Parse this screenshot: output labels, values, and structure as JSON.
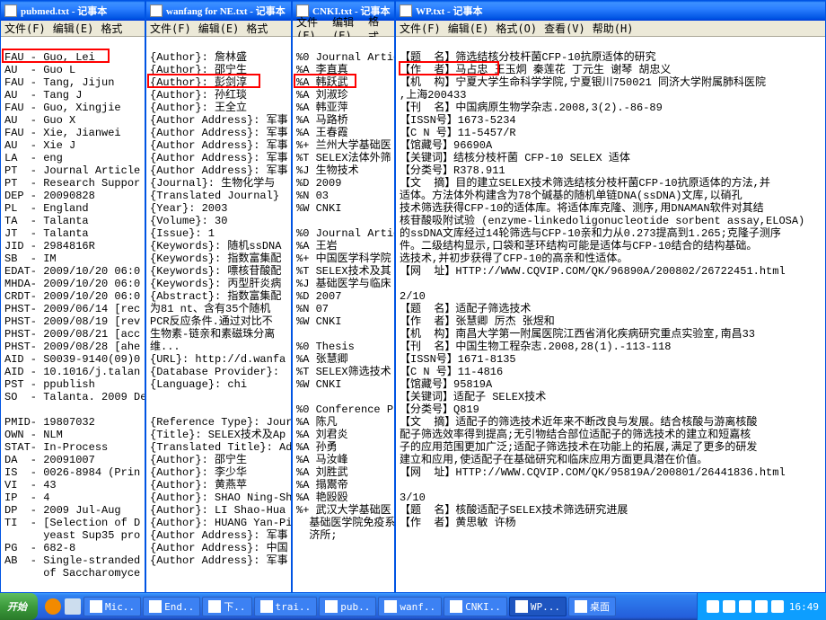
{
  "windows": {
    "pubmed": {
      "title": "pubmed.txt - 记事本",
      "menu": [
        "文件(F)",
        "编辑(E)",
        "格式"
      ],
      "lines": [
        "",
        "FAU - Guo, Lei",
        "AU  - Guo L",
        "FAU - Tang, Jijun",
        "AU  - Tang J",
        "FAU - Guo, Xingjie",
        "AU  - Guo X",
        "FAU - Xie, Jianwei",
        "AU  - Xie J",
        "LA  - eng",
        "PT  - Journal Article",
        "PT  - Research Suppor",
        "DEP - 20090828",
        "PL  - England",
        "TA  - Talanta",
        "JT  - Talanta",
        "JID - 2984816R",
        "SB  - IM",
        "EDAT- 2009/10/20 06:0",
        "MHDA- 2009/10/20 06:0",
        "CRDT- 2009/10/20 06:0",
        "PHST- 2009/06/14 [rec",
        "PHST- 2009/08/19 [rev",
        "PHST- 2009/08/21 [acc",
        "PHST- 2009/08/28 [ahe",
        "AID - S0039-9140(09)0",
        "AID - 10.1016/j.talan",
        "PST - ppublish",
        "SO  - Talanta. 2009 De",
        "",
        "PMID- 19807032",
        "OWN - NLM",
        "STAT- In-Process",
        "DA  - 20091007",
        "IS  - 0026-8984 (Prin",
        "VI  - 43",
        "IP  - 4",
        "DP  - 2009 Jul-Aug",
        "TI  - [Selection of D",
        "      yeast Sup35 pro",
        "PG  - 682-8",
        "AB  - Single-stranded",
        "      of Saccharomyce"
      ]
    },
    "wanfang": {
      "title": "wanfang for NE.txt - 记事本",
      "menu": [
        "文件(F)",
        "编辑(E)",
        "格式"
      ],
      "lines": [
        "",
        "{Author}: 詹林盛",
        "{Author}: 邵宁生",
        "{Author}: 彭剑淳",
        "{Author}: 孙红琰",
        "{Author}: 王全立",
        "{Author Address}: 军事",
        "{Author Address}: 军事",
        "{Author Address}: 军事",
        "{Author Address}: 军事",
        "{Author Address}: 军事",
        "{Journal}: 生物化学与",
        "{Translated Journal}",
        "{Year}: 2003",
        "{Volume}: 30",
        "{Issue}: 1",
        "{Keywords}: 随机ssDNA",
        "{Keywords}: 指数富集配",
        "{Keywords}: 嘌核苷酸配",
        "{Keywords}: 丙型肝炎病",
        "{Abstract}: 指数富集配",
        "为81 nt、含有35个随机",
        "PCR反应条件.通过对比不",
        "生物素-链亲和素磁珠分离",
        "维...",
        "{URL}: http://d.wanfa",
        "{Database Provider}:",
        "{Language}: chi",
        "",
        "",
        "{Reference Type}: Jour",
        "{Title}: SELEX技术及Ap",
        "{Translated Title}: Ad",
        "{Author}: 邵宁生",
        "{Author}: 李少华",
        "{Author}: 黄燕苹",
        "{Author}: SHAO Ning-Sh",
        "{Author}: LI Shao-Hua",
        "{Author}: HUANG Yan-Pi",
        "{Author Address}: 军事",
        "{Author Address}: 中国",
        "{Author Address}: 军事"
      ]
    },
    "cnki": {
      "title": "CNKI.txt - 记事本",
      "menu": [
        "文件(F)",
        "编辑(E)",
        "格式"
      ],
      "lines": [
        "",
        "%0 Journal Articl",
        "%A 李直真",
        "%A 韩跃武",
        "%A 刘淑珍",
        "%A 韩亚萍",
        "%A 马路桥",
        "%A 王春霞",
        "%+ 兰州大学基础医",
        "%T SELEX法体外筛",
        "%J 生物技术",
        "%D 2009",
        "%N 03",
        "%W CNKI",
        "",
        "%0 Journal Articl",
        "%A 王岩",
        "%+ 中国医学科学院",
        "%T SELEX技术及其",
        "%J 基础医学与临床",
        "%D 2007",
        "%N 07",
        "%W CNKI",
        "",
        "%0 Thesis",
        "%A 张慧卿",
        "%T SELEX筛选技术",
        "%W CNKI",
        "",
        "%0 Conference Pro",
        "%A 陈凡",
        "%A 刘君炎",
        "%A 孙勇",
        "%A 马汝峰",
        "%A 刘胜武",
        "%A 搨鬻帝",
        "%A 艳殴殴",
        "%+ 武汉大学基础医",
        "  基础医学院免疫系",
        "  济所;"
      ]
    },
    "wp": {
      "title": "WP.txt - 记事本",
      "menu": [
        "文件(F)",
        "编辑(E)",
        "格式(O)",
        "查看(V)",
        "帮助(H)"
      ],
      "lines": [
        "",
        "【题  名】筛选结核分枝杆菌CFP-10抗原适体的研究",
        "【作  者】马占忠 王玉炯 秦莲花 丁元生 谢琴 胡忠义",
        "【机  构】宁夏大学生命科学学院,宁夏银川750021 同济大学附属肺科医院",
        ",上海200433",
        "【刊  名】中国病原生物学杂志.2008,3(2).-86-89",
        "【ISSN号】1673-5234",
        "【C N 号】11-5457/R",
        "【馆藏号】96690A",
        "【关键词】结核分枝杆菌 CFP-10 SELEX 适体",
        "【分类号】R378.911",
        "【文  摘】目的建立SELEX技术筛选结核分枝杆菌CFP-10抗原适体的方法,并",
        "适体。方法体外构建含为78个碱基的随机单链DNA(ssDNA)文库,以硝孔",
        "技术筛选获得CFP-10的适体库。将适体库克隆、测序,用DNAMAN软件对其结",
        "核苷酸吸附试验 (enzyme-linkedoligonucleotide sorbent assay,ELOSA)",
        "的ssDNA文库经过14轮筛选与CFP-10亲和力从0.273提高到1.265;克隆子测序",
        "件。二级结构显示,口袋和茎环结构可能是适体与CFP-10结合的结构基础。",
        "选技术,并初步获得了CFP-10的高亲和性适体。",
        "【网  址】HTTP://WWW.CQVIP.COM/QK/96890A/200802/26722451.html",
        "",
        "2/10",
        "【题  名】适配子筛选技术",
        "【作  者】张慧卿 厉杰 张煜和",
        "【机  构】南昌大学第一附属医院江西省消化疾病研究重点实验室,南昌33",
        "【刊  名】中国生物工程杂志.2008,28(1).-113-118",
        "【ISSN号】1671-8135",
        "【C N 号】11-4816",
        "【馆藏号】95819A",
        "【关键词】适配子 SELEX技术",
        "【分类号】Q819",
        "【文  摘】适配子的筛选技术近年来不断改良与发展。结合核酸与游离核酸",
        "配子筛选效率得到提高;无引物结合部位适配子的筛选技术的建立和短嘉核",
        "子的应用范围更加广泛;适配子筛选技术在功能上的拓展,满足了更多的研发",
        "建立和应用,使适配子在基础研究和临床应用方面更具潜在价值。",
        "【网  址】HTTP://WWW.CQVIP.COM/QK/95819A/200801/26441836.html",
        "",
        "3/10",
        "【题  名】核酸适配子SELEX技术筛选研究进展",
        "【作  者】黄思敏 许杨"
      ]
    }
  },
  "highlights": {
    "h1": "AU  - Guo L",
    "h2": "{Author}: 彭剑淳",
    "h3": "%A 韩跃武",
    "h4": "【作  者】马占忠"
  },
  "taskbar": {
    "start": "开始",
    "tasks": [
      "Mic..",
      "End..",
      "下..",
      "trai..",
      "pub..",
      "wanf..",
      "CNKI..",
      "WP...",
      "桌面"
    ],
    "clock": "16:49"
  }
}
